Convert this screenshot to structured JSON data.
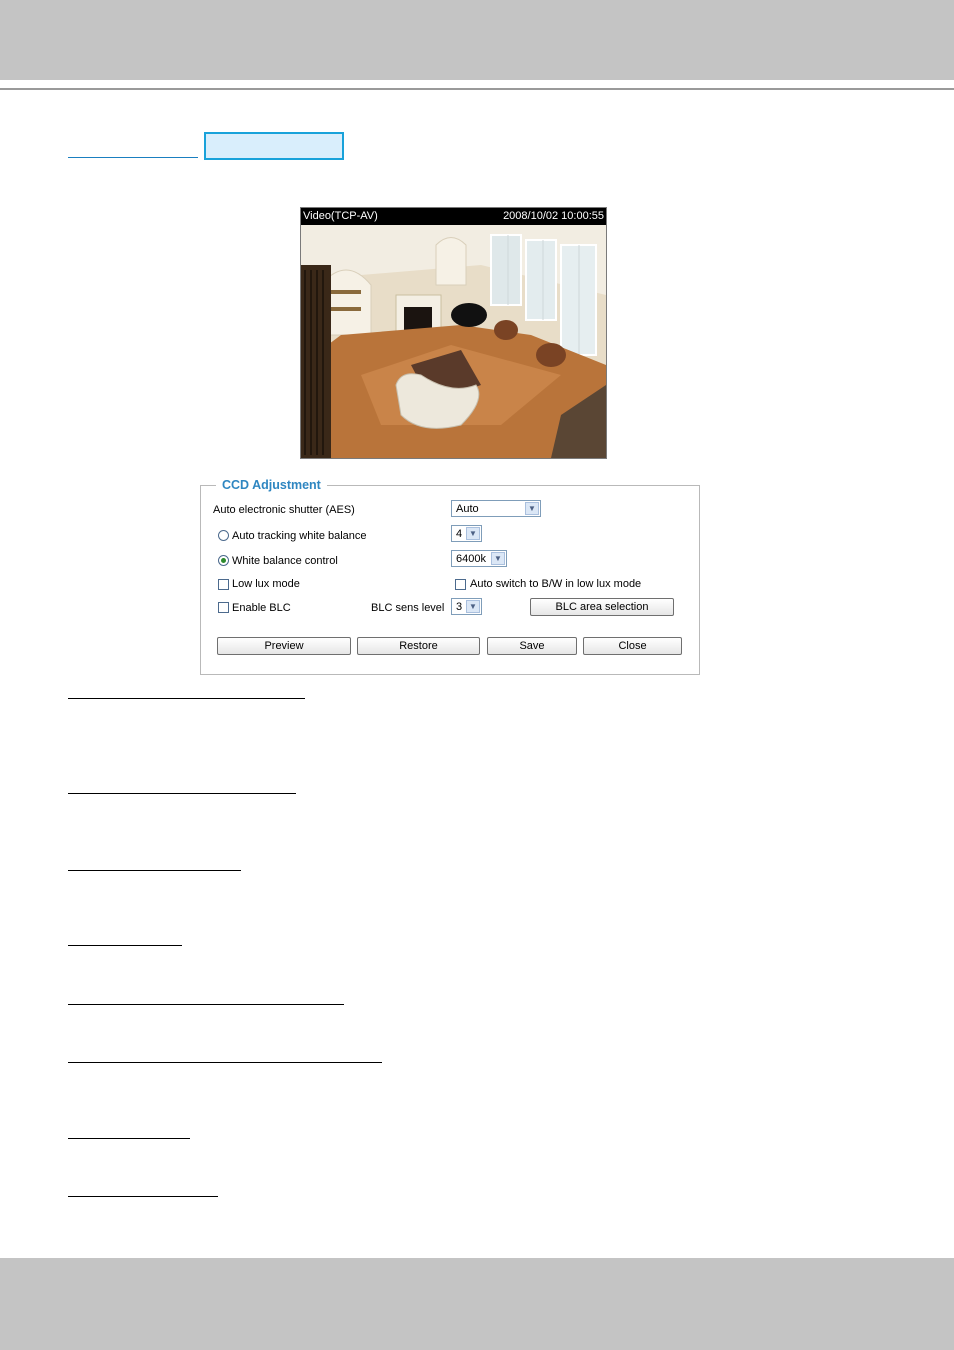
{
  "video": {
    "stream_label": "Video(TCP-AV)",
    "timestamp": "2008/10/02 10:00:55"
  },
  "ccd": {
    "title": "CCD Adjustment",
    "aes_label": "Auto electronic shutter (AES)",
    "aes_value": "Auto",
    "auto_wb_label": "Auto tracking white balance",
    "auto_wb_value": "4",
    "wb_control_label": "White balance control",
    "wb_control_value": "6400k",
    "selected_wb_mode": "White balance control",
    "low_lux_label": "Low lux mode",
    "auto_bw_label": "Auto switch to B/W in low lux mode",
    "enable_blc_label": "Enable BLC",
    "blc_sens_label": "BLC sens level",
    "blc_sens_value": "3",
    "blc_area_button": "BLC area selection",
    "buttons": {
      "preview": "Preview",
      "restore": "Restore",
      "save": "Save",
      "close": "Close"
    }
  },
  "colors": {
    "accent": "#2e86c1",
    "band": "#c4c4c4",
    "tab_fill": "#d9eefc",
    "tab_border": "#19a2da"
  }
}
